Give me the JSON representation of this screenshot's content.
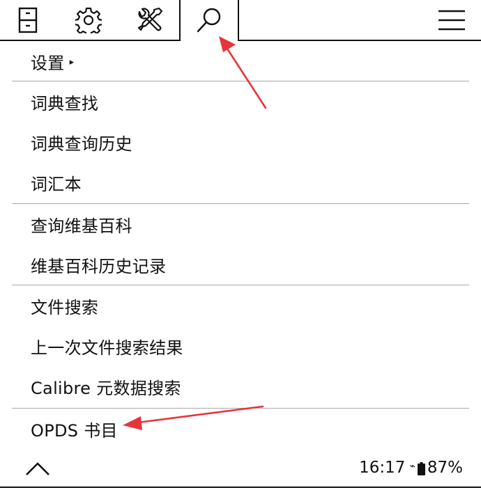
{
  "tabs": [
    {
      "id": "file",
      "icon": "file-cabinet-icon"
    },
    {
      "id": "settings",
      "icon": "gear-icon"
    },
    {
      "id": "tools",
      "icon": "tools-icon"
    },
    {
      "id": "search",
      "icon": "search-icon",
      "active": true
    },
    {
      "id": "menu",
      "icon": "hamburger-menu-icon"
    }
  ],
  "menu": {
    "items": [
      {
        "label": "设置",
        "submenu_indicator": "▸"
      },
      {
        "label": "词典查找"
      },
      {
        "label": "词典查询历史"
      },
      {
        "label": "词汇本"
      },
      {
        "label": "查询维基百科"
      },
      {
        "label": "维基百科历史记录"
      },
      {
        "label": "文件搜索"
      },
      {
        "label": "上一次文件搜索结果"
      },
      {
        "label": "Calibre 元数据搜索"
      },
      {
        "label": "OPDS 书目"
      }
    ]
  },
  "footer": {
    "up_icon": "chevron-up-icon",
    "time": "16:17",
    "wifi_icon": "⌁",
    "battery_percent": "87%"
  },
  "colors": {
    "annotation_arrow": "#e8333a",
    "separator": "#a8a8a8",
    "foreground": "#111111",
    "background": "#ffffff"
  }
}
